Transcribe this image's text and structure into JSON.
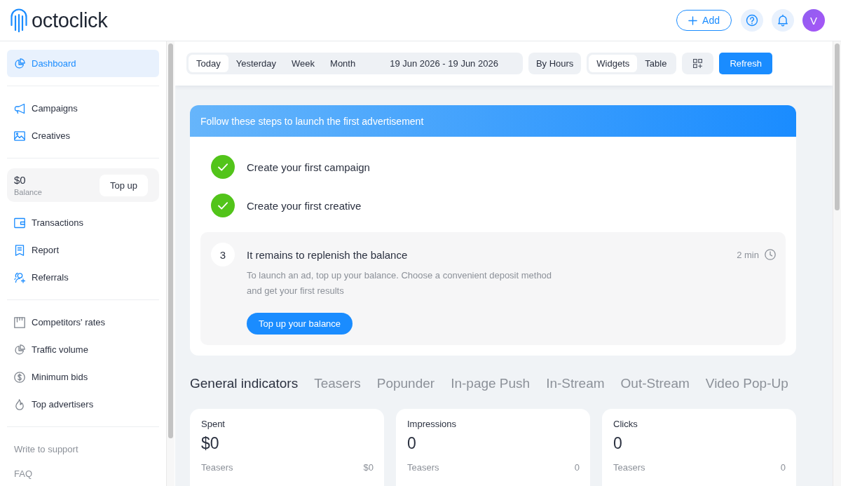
{
  "header": {
    "logo": "octoclick",
    "add_button": "Add",
    "avatar": "V"
  },
  "sidebar": {
    "primary_nav": [
      {
        "label": "Dashboard",
        "selected": true
      }
    ],
    "content_nav": [
      {
        "label": "Campaigns",
        "selected": false
      },
      {
        "label": "Creatives",
        "selected": false
      }
    ],
    "balance": {
      "amount": "$0",
      "label": "Balance",
      "button": "Top up"
    },
    "finance_nav": [
      {
        "label": "Transactions",
        "selected": false
      },
      {
        "label": "Report",
        "selected": false
      },
      {
        "label": "Referrals",
        "selected": false
      }
    ],
    "tools_nav": [
      {
        "label": "Competitors' rates",
        "selected": false
      },
      {
        "label": "Traffic volume",
        "selected": false
      },
      {
        "label": "Minimum bids",
        "selected": false
      },
      {
        "label": "Top advertisers",
        "selected": false
      }
    ],
    "help_links": [
      "Write to support",
      "FAQ"
    ]
  },
  "toolbar": {
    "periods": [
      {
        "label": "Today",
        "selected": true
      },
      {
        "label": "Yesterday",
        "selected": false
      },
      {
        "label": "Week",
        "selected": false
      },
      {
        "label": "Month",
        "selected": false
      }
    ],
    "date_range": "19 Jun 2026 - 19 Jun 2026",
    "grouping_button": "By Hours",
    "views": [
      {
        "label": "Widgets",
        "selected": true
      },
      {
        "label": "Table",
        "selected": false
      }
    ],
    "refresh_button": "Refresh"
  },
  "onboarding": {
    "title": "Follow these steps to launch the first advertisement",
    "steps": [
      {
        "title": "Create your first campaign",
        "done": true
      },
      {
        "title": "Create your first creative",
        "done": true
      },
      {
        "number": "3",
        "title": "It remains to replenish the balance",
        "done": false,
        "duration": "2 min",
        "description": "To launch an ad, top up your balance. Choose a convenient deposit method and get your first results",
        "button": "Top up your balance"
      }
    ]
  },
  "indicators": {
    "tabs": [
      {
        "label": "General indicators",
        "selected": true
      },
      {
        "label": "Teasers",
        "selected": false
      },
      {
        "label": "Popunder",
        "selected": false
      },
      {
        "label": "In-page Push",
        "selected": false
      },
      {
        "label": "In-Stream",
        "selected": false
      },
      {
        "label": "Out-Stream",
        "selected": false
      },
      {
        "label": "Video Pop-Up",
        "selected": false
      }
    ],
    "cards": [
      {
        "title": "Spent",
        "value": "$0",
        "rows": [
          {
            "label": "Teasers",
            "value": "$0"
          }
        ]
      },
      {
        "title": "Impressions",
        "value": "0",
        "rows": [
          {
            "label": "Teasers",
            "value": "0"
          }
        ]
      },
      {
        "title": "Clicks",
        "value": "0",
        "rows": [
          {
            "label": "Teasers",
            "value": "0"
          }
        ]
      }
    ]
  }
}
